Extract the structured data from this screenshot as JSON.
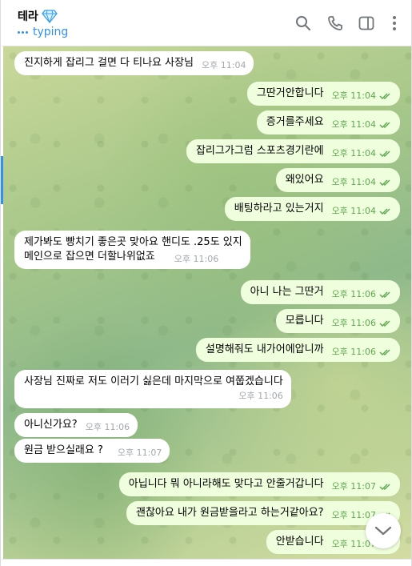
{
  "header": {
    "peer_name": "테라",
    "status": "typing"
  },
  "icons": {
    "peer_badge": "diamond-icon",
    "search": "search-icon",
    "call": "phone-icon",
    "sidebar": "sidebar-toggle-icon",
    "menu": "more-vertical-icon",
    "scroll": "chevron-down-icon"
  },
  "colors": {
    "accent": "#3390ec",
    "incoming_bubble": "#ffffff",
    "outgoing_bubble": "#effedd",
    "outgoing_meta": "#5ea84d"
  },
  "messages": [
    {
      "dir": "in",
      "text": "진지하게 잡리그 걸면 다 티나요 사장님",
      "time": "오후 11:04"
    },
    {
      "dir": "out",
      "text": "그딴거안합니다",
      "time": "오후 11:04"
    },
    {
      "dir": "out",
      "text": "증거를주세요",
      "time": "오후 11:04"
    },
    {
      "dir": "out",
      "text": "잡리그가그럼 스포츠경기란에",
      "time": "오후 11:04"
    },
    {
      "dir": "out",
      "text": "왜있어요",
      "time": "오후 11:04"
    },
    {
      "dir": "out",
      "text": "배팅하라고 있는거지",
      "time": "오후 11:04"
    },
    {
      "dir": "in",
      "lines": [
        "제가봐도 빵치기 좋은곳 맞아요 핸디도 .25도 있지",
        "메인으로 잡으면 더할나위없죠"
      ],
      "time": "오후 11:06"
    },
    {
      "dir": "out",
      "text": "아니 나는 그딴거",
      "time": "오후 11:06"
    },
    {
      "dir": "out",
      "text": "모릅니다",
      "time": "오후 11:06"
    },
    {
      "dir": "out",
      "text": "설명해줘도 내가어에압니까",
      "time": "오후 11:06"
    },
    {
      "dir": "in",
      "lines": [
        "사장님 진짜로 저도 이러기 싫은데 마지막으로 여쭙겠습니다"
      ],
      "time": "오후 11:06"
    },
    {
      "dir": "in",
      "text": "아니신가요?",
      "time": "오후 11:06"
    },
    {
      "dir": "in",
      "text": "원금 받으실래요 ?",
      "time": "오후 11:07"
    },
    {
      "dir": "out",
      "text": "아닙니다 뭐 아니라해도 맞다고 안줄거갑니다",
      "time": "오후 11:07"
    },
    {
      "dir": "out",
      "text": "괜찮아요 내가 원금받을라고 하는거같아요?",
      "time": "오후 11:07"
    },
    {
      "dir": "out",
      "text": "안받습니다",
      "time": "오후 11:07"
    }
  ]
}
